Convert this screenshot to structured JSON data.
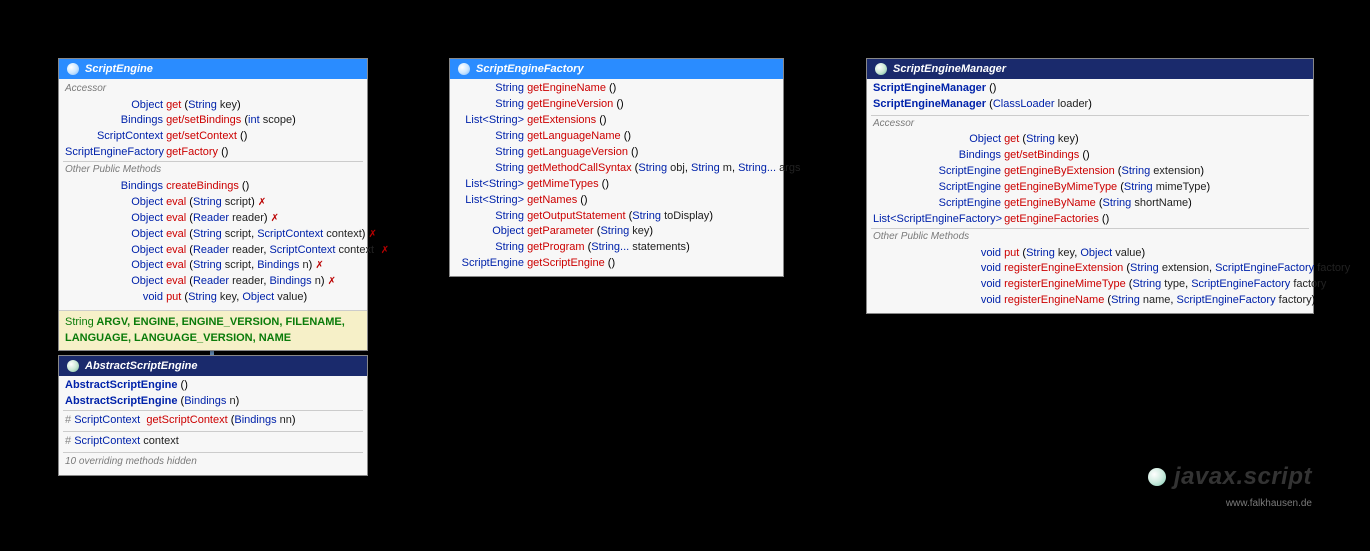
{
  "package": {
    "name": "javax.script"
  },
  "credit": "www.falkhausen.de",
  "scriptEngine": {
    "title": "ScriptEngine",
    "sections": {
      "accessor": "Accessor",
      "other": "Other Public Methods"
    },
    "accessor": [
      {
        "ret": "Object",
        "name": "get",
        "params": [
          [
            "String",
            "key"
          ]
        ]
      },
      {
        "ret": "Bindings",
        "name": "get/setBindings",
        "params": [
          [
            "int",
            "scope"
          ]
        ]
      },
      {
        "ret": "ScriptContext",
        "name": "get/setContext",
        "params": []
      },
      {
        "ret": "ScriptEngineFactory",
        "name": "getFactory",
        "params": []
      }
    ],
    "methods": [
      {
        "ret": "Bindings",
        "name": "createBindings",
        "params": []
      },
      {
        "ret": "Object",
        "name": "eval",
        "params": [
          [
            "String",
            "script"
          ]
        ],
        "exc": true
      },
      {
        "ret": "Object",
        "name": "eval",
        "params": [
          [
            "Reader",
            "reader"
          ]
        ],
        "exc": true
      },
      {
        "ret": "Object",
        "name": "eval",
        "params": [
          [
            "String",
            "script"
          ],
          [
            "ScriptContext",
            "context"
          ]
        ],
        "exc": true
      },
      {
        "ret": "Object",
        "name": "eval",
        "params": [
          [
            "Reader",
            "reader"
          ],
          [
            "ScriptContext",
            "context"
          ]
        ],
        "exc": true
      },
      {
        "ret": "Object",
        "name": "eval",
        "params": [
          [
            "String",
            "script"
          ],
          [
            "Bindings",
            "n"
          ]
        ],
        "exc": true
      },
      {
        "ret": "Object",
        "name": "eval",
        "params": [
          [
            "Reader",
            "reader"
          ],
          [
            "Bindings",
            "n"
          ]
        ],
        "exc": true
      },
      {
        "ret": "void",
        "name": "put",
        "params": [
          [
            "String",
            "key"
          ],
          [
            "Object",
            "value"
          ]
        ]
      }
    ],
    "constantsPrefix": "String",
    "constants": "ARGV, ENGINE, ENGINE_VERSION, FILENAME, LANGUAGE, LANGUAGE_VERSION, NAME"
  },
  "abstractScriptEngine": {
    "title": "AbstractScriptEngine",
    "ctors": [
      {
        "name": "AbstractScriptEngine",
        "params": []
      },
      {
        "name": "AbstractScriptEngine",
        "params": [
          [
            "Bindings",
            "n"
          ]
        ]
      }
    ],
    "method": {
      "vis": "#",
      "ret": "ScriptContext",
      "name": "getScriptContext",
      "params": [
        [
          "Bindings",
          "nn"
        ]
      ]
    },
    "field": {
      "vis": "#",
      "type": "ScriptContext",
      "name": "context"
    },
    "hidden": "10 overriding methods hidden"
  },
  "scriptEngineFactory": {
    "title": "ScriptEngineFactory",
    "methods": [
      {
        "ret": "String",
        "name": "getEngineName",
        "params": []
      },
      {
        "ret": "String",
        "name": "getEngineVersion",
        "params": []
      },
      {
        "ret": "List<String>",
        "name": "getExtensions",
        "params": []
      },
      {
        "ret": "String",
        "name": "getLanguageName",
        "params": []
      },
      {
        "ret": "String",
        "name": "getLanguageVersion",
        "params": []
      },
      {
        "ret": "String",
        "name": "getMethodCallSyntax",
        "params": [
          [
            "String",
            "obj"
          ],
          [
            "String",
            "m"
          ],
          [
            "String...",
            "args"
          ]
        ]
      },
      {
        "ret": "List<String>",
        "name": "getMimeTypes",
        "params": []
      },
      {
        "ret": "List<String>",
        "name": "getNames",
        "params": []
      },
      {
        "ret": "String",
        "name": "getOutputStatement",
        "params": [
          [
            "String",
            "toDisplay"
          ]
        ]
      },
      {
        "ret": "Object",
        "name": "getParameter",
        "params": [
          [
            "String",
            "key"
          ]
        ]
      },
      {
        "ret": "String",
        "name": "getProgram",
        "params": [
          [
            "String...",
            "statements"
          ]
        ]
      },
      {
        "ret": "ScriptEngine",
        "name": "getScriptEngine",
        "params": []
      }
    ]
  },
  "scriptEngineManager": {
    "title": "ScriptEngineManager",
    "ctors": [
      {
        "name": "ScriptEngineManager",
        "params": []
      },
      {
        "name": "ScriptEngineManager",
        "params": [
          [
            "ClassLoader",
            "loader"
          ]
        ]
      }
    ],
    "sections": {
      "accessor": "Accessor",
      "other": "Other Public Methods"
    },
    "accessor": [
      {
        "ret": "Object",
        "name": "get",
        "params": [
          [
            "String",
            "key"
          ]
        ]
      },
      {
        "ret": "Bindings",
        "name": "get/setBindings",
        "params": []
      },
      {
        "ret": "ScriptEngine",
        "name": "getEngineByExtension",
        "params": [
          [
            "String",
            "extension"
          ]
        ]
      },
      {
        "ret": "ScriptEngine",
        "name": "getEngineByMimeType",
        "params": [
          [
            "String",
            "mimeType"
          ]
        ]
      },
      {
        "ret": "ScriptEngine",
        "name": "getEngineByName",
        "params": [
          [
            "String",
            "shortName"
          ]
        ]
      },
      {
        "ret": "List<ScriptEngineFactory>",
        "name": "getEngineFactories",
        "params": []
      }
    ],
    "methods": [
      {
        "ret": "void",
        "name": "put",
        "params": [
          [
            "String",
            "key"
          ],
          [
            "Object",
            "value"
          ]
        ]
      },
      {
        "ret": "void",
        "name": "registerEngineExtension",
        "params": [
          [
            "String",
            "extension"
          ],
          [
            "ScriptEngineFactory",
            "factory"
          ]
        ]
      },
      {
        "ret": "void",
        "name": "registerEngineMimeType",
        "params": [
          [
            "String",
            "type"
          ],
          [
            "ScriptEngineFactory",
            "factory"
          ]
        ]
      },
      {
        "ret": "void",
        "name": "registerEngineName",
        "params": [
          [
            "String",
            "name"
          ],
          [
            "ScriptEngineFactory",
            "factory"
          ]
        ]
      }
    ]
  }
}
